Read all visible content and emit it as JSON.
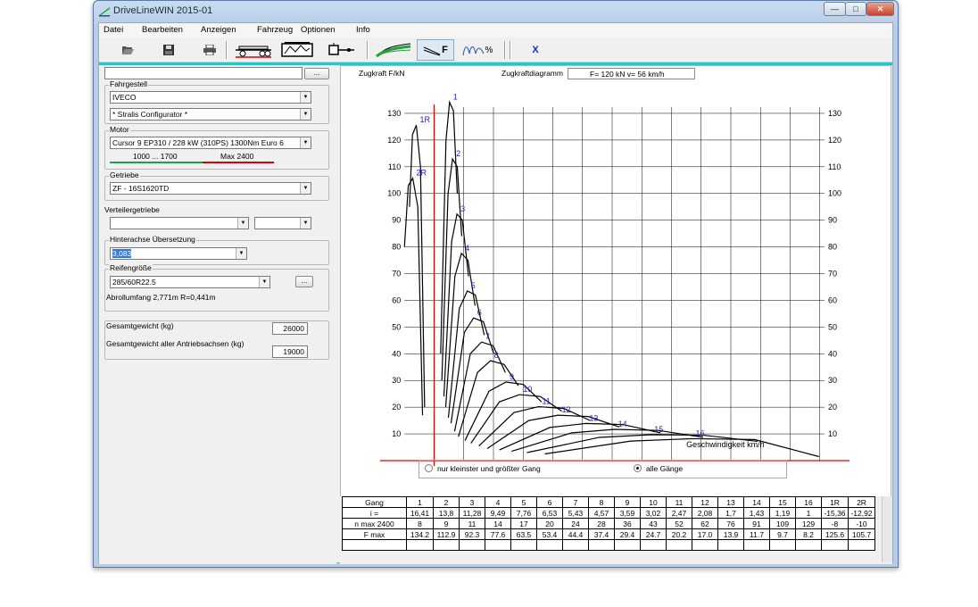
{
  "window": {
    "title": "DriveLineWIN 2015-01"
  },
  "menu": [
    "Datei",
    "Bearbeiten",
    "Anzeigen",
    "Fahrzeug",
    "Optionen",
    "Info"
  ],
  "toolbar": {
    "x_label": "X",
    "f_label": "F",
    "pct_label": "%"
  },
  "left": {
    "top_input_value": "",
    "top_button": "...",
    "fahrgestell": {
      "label": "Fahrgestell",
      "make": "IVECO",
      "model": "* Stralis Configurator *"
    },
    "motor": {
      "label": "Motor",
      "value": "Cursor 9 EP310 / 228 kW (310PS) 1300Nm Euro 6",
      "range_green": "1000 ... 1700",
      "range_red": "Max 2400"
    },
    "getriebe": {
      "label": "Getriebe",
      "value": "ZF - 16S1620TD"
    },
    "verteiler": {
      "label": "Verteilergetriebe",
      "value1": "",
      "value2": ""
    },
    "hinterachse": {
      "label": "Hinterachse Übersetzung",
      "value": "3,083"
    },
    "reifen": {
      "label": "Reifengröße",
      "value": "285/60R22.5",
      "button": "...",
      "info": "Abrollumfang 2,771m   R=0,441m"
    },
    "gesamtgewicht": {
      "label": "Gesamtgewicht (kg)",
      "value": "26000"
    },
    "antriebsachsen": {
      "label": "Gesamtgewicht aller Antriebsachsen (kg)",
      "value": "19000"
    }
  },
  "chart_header": {
    "ylabel": "Zugkraft F/kN",
    "title": "Zugkraftdiagramm",
    "readout": "F= 120 kN    v= 56 km/h"
  },
  "radio": {
    "option1": "nur kleinster und größter Gang",
    "option2": "alle Gänge",
    "selected": "alle Gänge"
  },
  "colors": {
    "teal": "#2bc3c3",
    "axis_red": "#e00000",
    "gear_label": "#2020c0",
    "green": "#1fa33a"
  },
  "chart_data": {
    "type": "line",
    "title": "Zugkraftdiagramm",
    "ylabel": "Zugkraft F/kN",
    "xlabel": "Geschwindigkeit km/h",
    "xlim": [
      -20,
      140
    ],
    "ylim": [
      0,
      135
    ],
    "x_ticks": [
      -20,
      -10,
      0,
      10,
      20,
      30,
      40,
      50,
      60,
      70,
      80,
      90,
      100,
      110,
      120,
      130,
      140
    ],
    "y_ticks": [
      10,
      20,
      30,
      40,
      50,
      60,
      70,
      80,
      90,
      100,
      110,
      120,
      130
    ],
    "grid": true,
    "series": [
      {
        "name": "1",
        "x": [
          2.2,
          4.0,
          5.2,
          6.5,
          7.8
        ],
        "y": [
          40,
          120,
          134.2,
          131,
          100
        ]
      },
      {
        "name": "2",
        "x": [
          2.6,
          4.7,
          6.2,
          7.8,
          9.3
        ],
        "y": [
          30,
          100,
          112.9,
          110,
          84
        ]
      },
      {
        "name": "3",
        "x": [
          3.3,
          5.9,
          7.7,
          9.5,
          11.6
        ],
        "y": [
          24,
          82,
          92.3,
          90,
          69
        ]
      },
      {
        "name": "4",
        "x": [
          3.9,
          7.0,
          9.2,
          11.4,
          13.8
        ],
        "y": [
          20,
          69,
          77.6,
          75,
          58
        ]
      },
      {
        "name": "5",
        "x": [
          4.8,
          8.5,
          11.2,
          13.9,
          16.9
        ],
        "y": [
          16,
          57,
          63.5,
          62,
          47
        ]
      },
      {
        "name": "6",
        "x": [
          5.7,
          10.2,
          13.3,
          16.6,
          20.1
        ],
        "y": [
          14,
          48,
          53.4,
          52,
          40
        ]
      },
      {
        "name": "7",
        "x": [
          6.9,
          12.2,
          16.0,
          19.9,
          24.0
        ],
        "y": [
          11,
          40,
          44.4,
          43,
          33
        ]
      },
      {
        "name": "8",
        "x": [
          8.2,
          14.6,
          19.0,
          23.6,
          28.4
        ],
        "y": [
          9,
          33,
          37.4,
          36,
          28
        ]
      },
      {
        "name": "9",
        "x": [
          10.4,
          18.5,
          24.2,
          30.1,
          36.2
        ],
        "y": [
          7.5,
          26,
          29.4,
          28.5,
          22
        ]
      },
      {
        "name": "10",
        "x": [
          12.4,
          22.0,
          28.8,
          35.8,
          43.0
        ],
        "y": [
          6.5,
          22,
          24.7,
          24,
          18.5
        ]
      },
      {
        "name": "11",
        "x": [
          15.1,
          26.9,
          35.2,
          43.8,
          52.6
        ],
        "y": [
          5.5,
          18,
          20.2,
          19.5,
          15
        ]
      },
      {
        "name": "12",
        "x": [
          17.9,
          31.9,
          41.8,
          52.0,
          62.4
        ],
        "y": [
          4.5,
          15,
          17.0,
          16.5,
          12.6
        ]
      },
      {
        "name": "13",
        "x": [
          22.0,
          39.0,
          51.1,
          63.6,
          76.3
        ],
        "y": [
          4,
          12.4,
          13.9,
          13.5,
          10.4
        ]
      },
      {
        "name": "14",
        "x": [
          26.1,
          46.4,
          60.8,
          75.6,
          90.7
        ],
        "y": [
          3.5,
          10.4,
          11.7,
          11.3,
          8.7
        ]
      },
      {
        "name": "15",
        "x": [
          31.3,
          55.7,
          73.0,
          90.8,
          109
        ],
        "y": [
          3,
          8.7,
          9.7,
          9.5,
          7.2
        ]
      },
      {
        "name": "16",
        "x": [
          37.3,
          66.3,
          86.9,
          108,
          129.7
        ],
        "y": [
          2.5,
          7.3,
          8.2,
          7.9,
          1.5
        ]
      },
      {
        "name": "1R",
        "x": [
          -3.2,
          -4.6,
          -6.0,
          -7.3,
          -8.3
        ],
        "y": [
          20,
          110,
          125.6,
          122,
          95
        ]
      },
      {
        "name": "2R",
        "x": [
          -3.9,
          -5.5,
          -7.2,
          -8.7,
          -10.0
        ],
        "y": [
          17,
          95,
          105.7,
          103,
          80
        ]
      }
    ]
  },
  "table": {
    "headers": [
      "Gang",
      "1",
      "2",
      "3",
      "4",
      "5",
      "6",
      "7",
      "8",
      "9",
      "10",
      "11",
      "12",
      "13",
      "14",
      "15",
      "16",
      "1R",
      "2R"
    ],
    "rows": [
      [
        "i =",
        "16,41",
        "13,8",
        "11,28",
        "9,49",
        "7,76",
        "6,53",
        "5,43",
        "4,57",
        "3,59",
        "3,02",
        "2,47",
        "2,08",
        "1,7",
        "1,43",
        "1,19",
        "1",
        "-15,36",
        "-12,92"
      ],
      [
        "n max 2400",
        "8",
        "9",
        "11",
        "14",
        "17",
        "20",
        "24",
        "28",
        "36",
        "43",
        "52",
        "62",
        "76",
        "91",
        "109",
        "129",
        "-8",
        "-10"
      ],
      [
        "F max",
        "134.2",
        "112.9",
        "92.3",
        "77.6",
        "63.5",
        "53.4",
        "44.4",
        "37.4",
        "29.4",
        "24.7",
        "20.2",
        "17.0",
        "13.9",
        "11.7",
        "9.7",
        "8.2",
        "125.6",
        "105.7"
      ]
    ]
  }
}
